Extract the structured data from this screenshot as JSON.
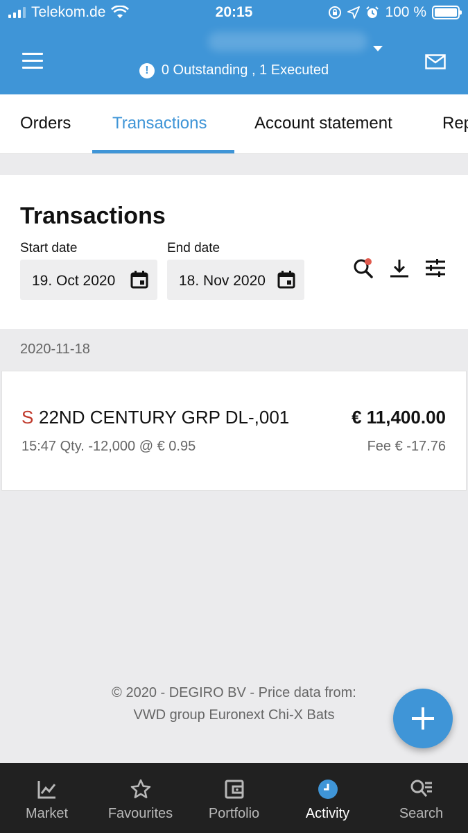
{
  "status_bar": {
    "carrier": "Telekom.de",
    "time": "20:15",
    "battery": "100 %",
    "battery_level": 1.0
  },
  "header": {
    "order_summary": "0 Outstanding , 1 Executed"
  },
  "tabs": [
    {
      "label": "Orders",
      "active": false
    },
    {
      "label": "Transactions",
      "active": true
    },
    {
      "label": "Account statement",
      "active": false
    },
    {
      "label": "Reports",
      "active": false
    }
  ],
  "card": {
    "title": "Transactions",
    "start_date_label": "Start date",
    "start_date": "19. Oct 2020",
    "end_date_label": "End date",
    "end_date": "18. Nov 2020"
  },
  "transactions": {
    "date_group": "2020-11-18",
    "items": [
      {
        "side": "S",
        "product": "22ND CENTURY GRP DL-,001",
        "amount": "€ 11,400.00",
        "details": "15:47 Qty. -12,000 @ € 0.95",
        "fee": "Fee € -17.76"
      }
    ]
  },
  "footer": {
    "line1": "© 2020 - DEGIRO BV - Price data from:",
    "line2": "VWD group Euronext Chi-X Bats"
  },
  "bottom_nav": [
    {
      "label": "Market",
      "icon": "chart-icon",
      "active": false
    },
    {
      "label": "Favourites",
      "icon": "star-icon",
      "active": false
    },
    {
      "label": "Portfolio",
      "icon": "wallet-icon",
      "active": false
    },
    {
      "label": "Activity",
      "icon": "clock-icon",
      "active": true
    },
    {
      "label": "Search",
      "icon": "search-list-icon",
      "active": false
    }
  ],
  "colors": {
    "brand": "#3f95d7",
    "sell": "#c0392b",
    "nav_bg": "#212121"
  }
}
